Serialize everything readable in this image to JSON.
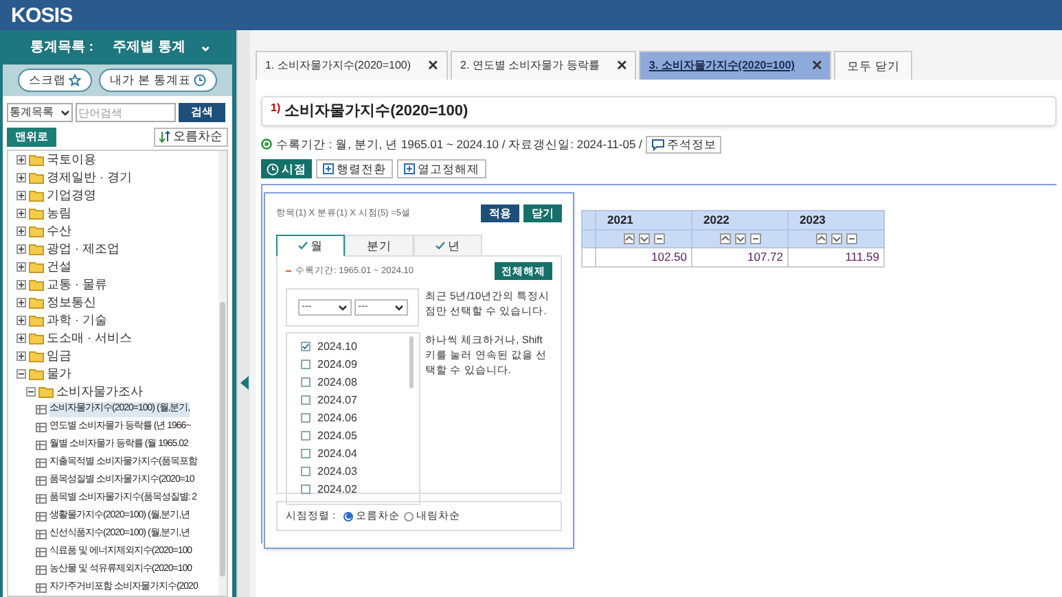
{
  "header": {
    "logo": "KOSIS"
  },
  "sidebar": {
    "title": "통계목록 :",
    "category": "주제별 통계",
    "category_caret": "⌄",
    "buttons": [
      {
        "label": "스크랩",
        "kind": "star"
      },
      {
        "label": "내가 본 통계표",
        "kind": "clock"
      }
    ],
    "search": {
      "scope": "통계목록",
      "placeholder": "단어검색",
      "button": "검색"
    },
    "top_button": "맨위로",
    "sort_button": "오름차순",
    "tree": [
      {
        "label": "국토이용",
        "kind": "folder",
        "expanded": false
      },
      {
        "label": "경제일반 · 경기",
        "kind": "folder",
        "expanded": false
      },
      {
        "label": "기업경영",
        "kind": "folder",
        "expanded": false
      },
      {
        "label": "농림",
        "kind": "folder",
        "expanded": false
      },
      {
        "label": "수산",
        "kind": "folder",
        "expanded": false
      },
      {
        "label": "광업 · 제조업",
        "kind": "folder",
        "expanded": false
      },
      {
        "label": "건설",
        "kind": "folder",
        "expanded": false
      },
      {
        "label": "교통 · 물류",
        "kind": "folder",
        "expanded": false
      },
      {
        "label": "정보통신",
        "kind": "folder",
        "expanded": false
      },
      {
        "label": "과학 · 기술",
        "kind": "folder",
        "expanded": false
      },
      {
        "label": "도소매 · 서비스",
        "kind": "folder",
        "expanded": false
      },
      {
        "label": "임금",
        "kind": "folder",
        "expanded": false
      },
      {
        "label": "물가",
        "kind": "folder",
        "expanded": true,
        "children": [
          {
            "label": "소비자물가조사",
            "kind": "folder",
            "expanded": true,
            "children": [
              {
                "label": "소비자물가지수(2020=100) (월,분기,",
                "kind": "table",
                "selected": true
              },
              {
                "label": "연도별 소비자물가 등락률 (년 1966~",
                "kind": "table",
                "selected": false
              },
              {
                "label": "월별 소비자물가 등락률 (월 1965.02",
                "kind": "table",
                "selected": false
              },
              {
                "label": "지출목적별 소비자물가지수(품목포함",
                "kind": "table",
                "selected": false
              },
              {
                "label": "품목성질별 소비자물가지수(2020=10",
                "kind": "table",
                "selected": false
              },
              {
                "label": "품목별 소비자물가지수(품목성질별: 2",
                "kind": "table",
                "selected": false
              },
              {
                "label": "생활물가지수(2020=100) (월,분기,년",
                "kind": "table",
                "selected": false
              },
              {
                "label": "신선식품지수(2020=100) (월,분기,년",
                "kind": "table",
                "selected": false
              },
              {
                "label": "식료품 및 에너지제외지수(2020=100",
                "kind": "table",
                "selected": false
              },
              {
                "label": "농산물 및 석유류제외지수(2020=100",
                "kind": "table",
                "selected": false
              },
              {
                "label": "자가주거비포함 소비자물가지수(2020",
                "kind": "table",
                "selected": false
              }
            ]
          }
        ]
      }
    ]
  },
  "tabs": [
    {
      "label": "1. 소비자물가지수(2020=100)",
      "close": "✕",
      "selected": false
    },
    {
      "label": "2. 연도별 소비자물가 등락률",
      "close": "✕",
      "selected": false
    },
    {
      "label": "3. 소비자물가지수(2020=100)",
      "close": "✕",
      "selected": true
    }
  ],
  "close_all": "모두 닫기",
  "table_title": {
    "note": "1)",
    "title": "소비자물가지수(2020=100)"
  },
  "info": {
    "text": "수록기간 : 월, 분기, 년 1965.01 ~ 2024.10 / 자료갱신일: 2024-11-05 /",
    "button": "주석정보"
  },
  "toolbar": [
    {
      "label": "시점",
      "kind": "primary"
    },
    {
      "label": "행렬전환",
      "kind": "plain"
    },
    {
      "label": "열고정해제",
      "kind": "plain"
    }
  ],
  "popup": {
    "summary": "항목(1) X 분류(1) X 시점(5) =5셀",
    "apply": "적용",
    "close": "닫기",
    "period_tabs": [
      {
        "label": "월",
        "checked": true,
        "selected": true
      },
      {
        "label": "분기",
        "checked": false,
        "selected": false
      },
      {
        "label": "년",
        "checked": true,
        "selected": false
      }
    ],
    "range": "수록기간: 1965.01 ~ 2024.10",
    "clear_all": "전체해제",
    "recent_from": "---",
    "recent_to": "---",
    "hint_1": "최근 5년/10년간의 특정시점만 선택할 수 있습니다.",
    "hint_2": "하나씩 체크하거나, Shift키를 눌러 연속된 값을 선택할 수 있습니다.",
    "periods": [
      {
        "label": "2024.10",
        "checked": true
      },
      {
        "label": "2024.09",
        "checked": false
      },
      {
        "label": "2024.08",
        "checked": false
      },
      {
        "label": "2024.07",
        "checked": false
      },
      {
        "label": "2024.06",
        "checked": false
      },
      {
        "label": "2024.05",
        "checked": false
      },
      {
        "label": "2024.04",
        "checked": false
      },
      {
        "label": "2024.03",
        "checked": false
      },
      {
        "label": "2024.02",
        "checked": false
      }
    ],
    "sort_label": "시점정렬 :",
    "sort_options": [
      {
        "label": "오름차순",
        "selected": true
      },
      {
        "label": "내림차순",
        "selected": false
      }
    ]
  },
  "table": {
    "columns": [
      "2021",
      "2022",
      "2023"
    ],
    "values": [
      "102.50",
      "107.72",
      "111.59"
    ]
  }
}
